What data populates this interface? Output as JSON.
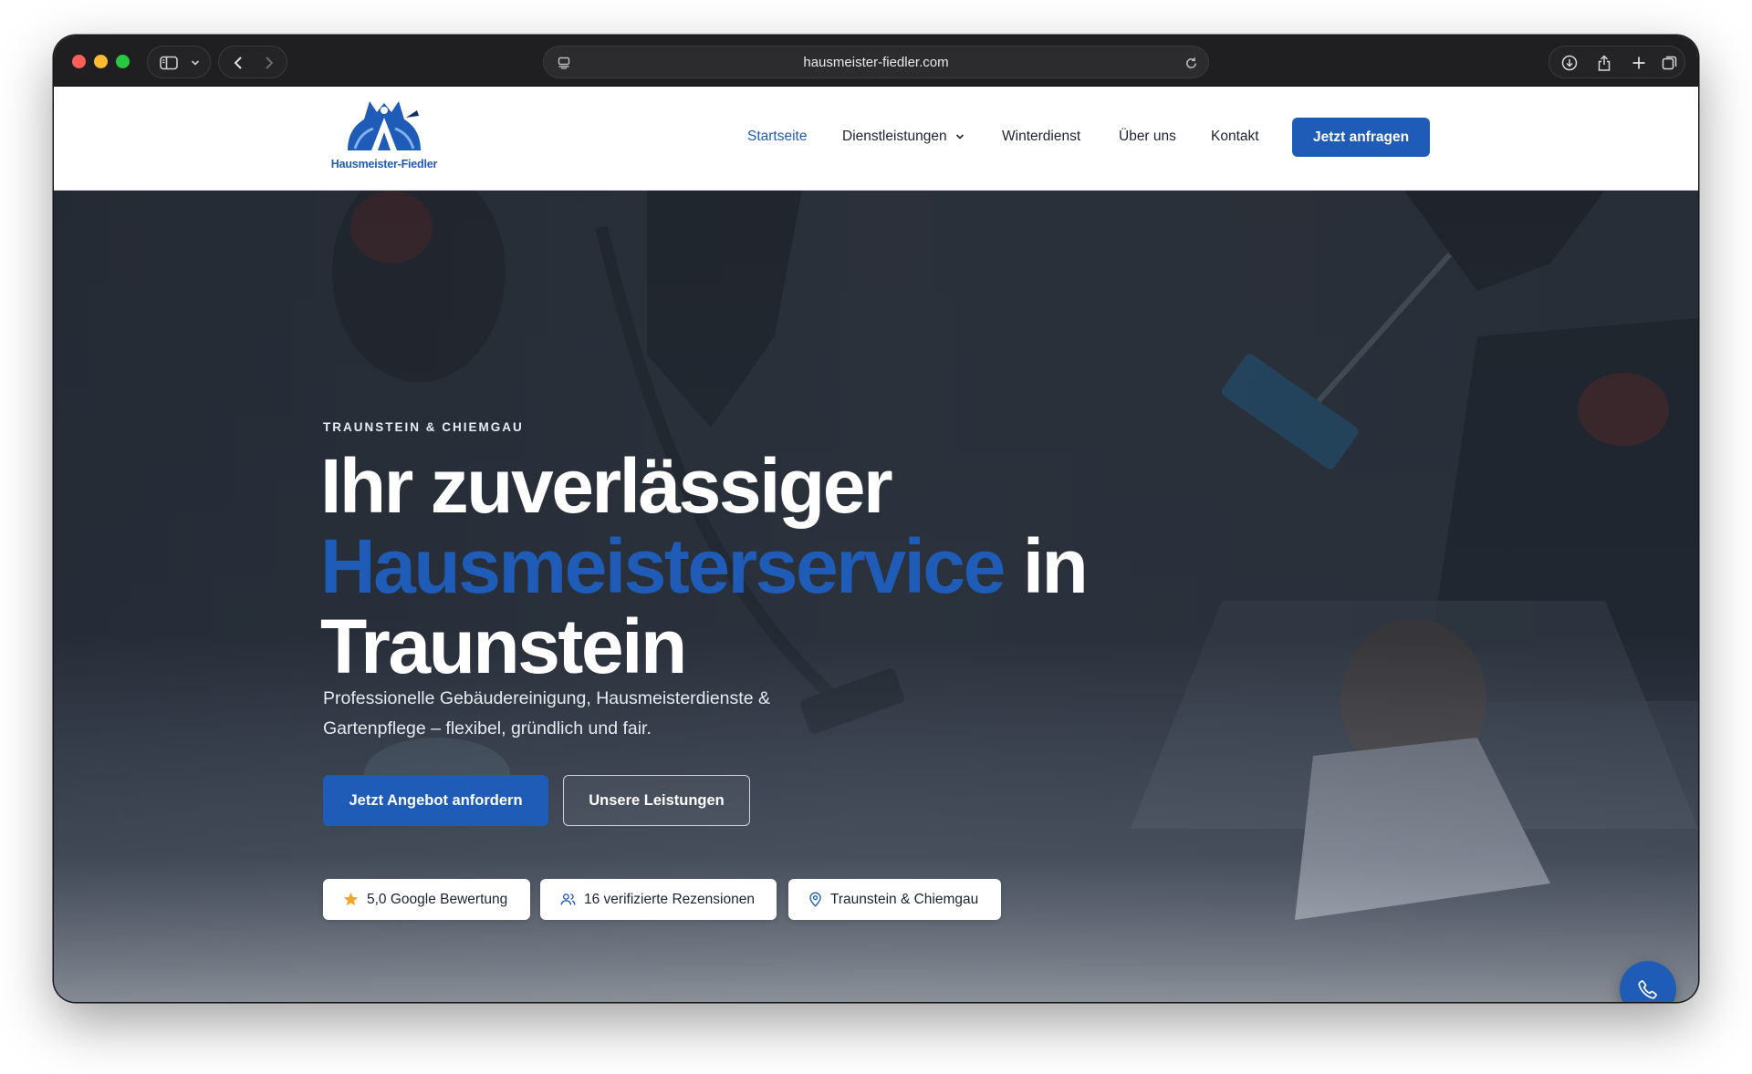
{
  "browser": {
    "url": "hausmeister-fiedler.com",
    "icons": [
      "sidebar-icon",
      "chevron-down-icon",
      "back-icon",
      "forward-icon",
      "page-menu-icon",
      "reload-icon",
      "download-icon",
      "share-icon",
      "new-tab-icon",
      "tab-overview-icon"
    ]
  },
  "header": {
    "logo_text": "Hausmeister-Fiedler",
    "nav": [
      {
        "label": "Startseite",
        "active": true
      },
      {
        "label": "Dienstleistungen",
        "dropdown": true
      },
      {
        "label": "Winterdienst"
      },
      {
        "label": "Über uns"
      },
      {
        "label": "Kontakt"
      }
    ],
    "cta_label": "Jetzt anfragen"
  },
  "hero": {
    "eyebrow": "TRAUNSTEIN & CHIEMGAU",
    "headline_line1": "Ihr zuverlässiger",
    "headline_accent": "Hausmeisterservice",
    "headline_in": " in",
    "headline_line3": "Traunstein",
    "subline": "Professionelle Gebäudereinigung, Hausmeisterdienste & Gartenpflege – flexibel, gründlich und fair.",
    "primary_button": "Jetzt Angebot anfordern",
    "secondary_button": "Unsere Leistungen",
    "badges": [
      {
        "icon": "star-icon",
        "label": "5,0 Google Bewertung"
      },
      {
        "icon": "users-icon",
        "label": "16 verifizierte Rezensionen"
      },
      {
        "icon": "map-pin-icon",
        "label": "Traunstein & Chiemgau"
      }
    ]
  },
  "fab": {
    "icon": "phone-icon"
  },
  "colors": {
    "brand": "#1f5cb8",
    "star": "#f5a623",
    "titlebar": "#1f1f21"
  }
}
